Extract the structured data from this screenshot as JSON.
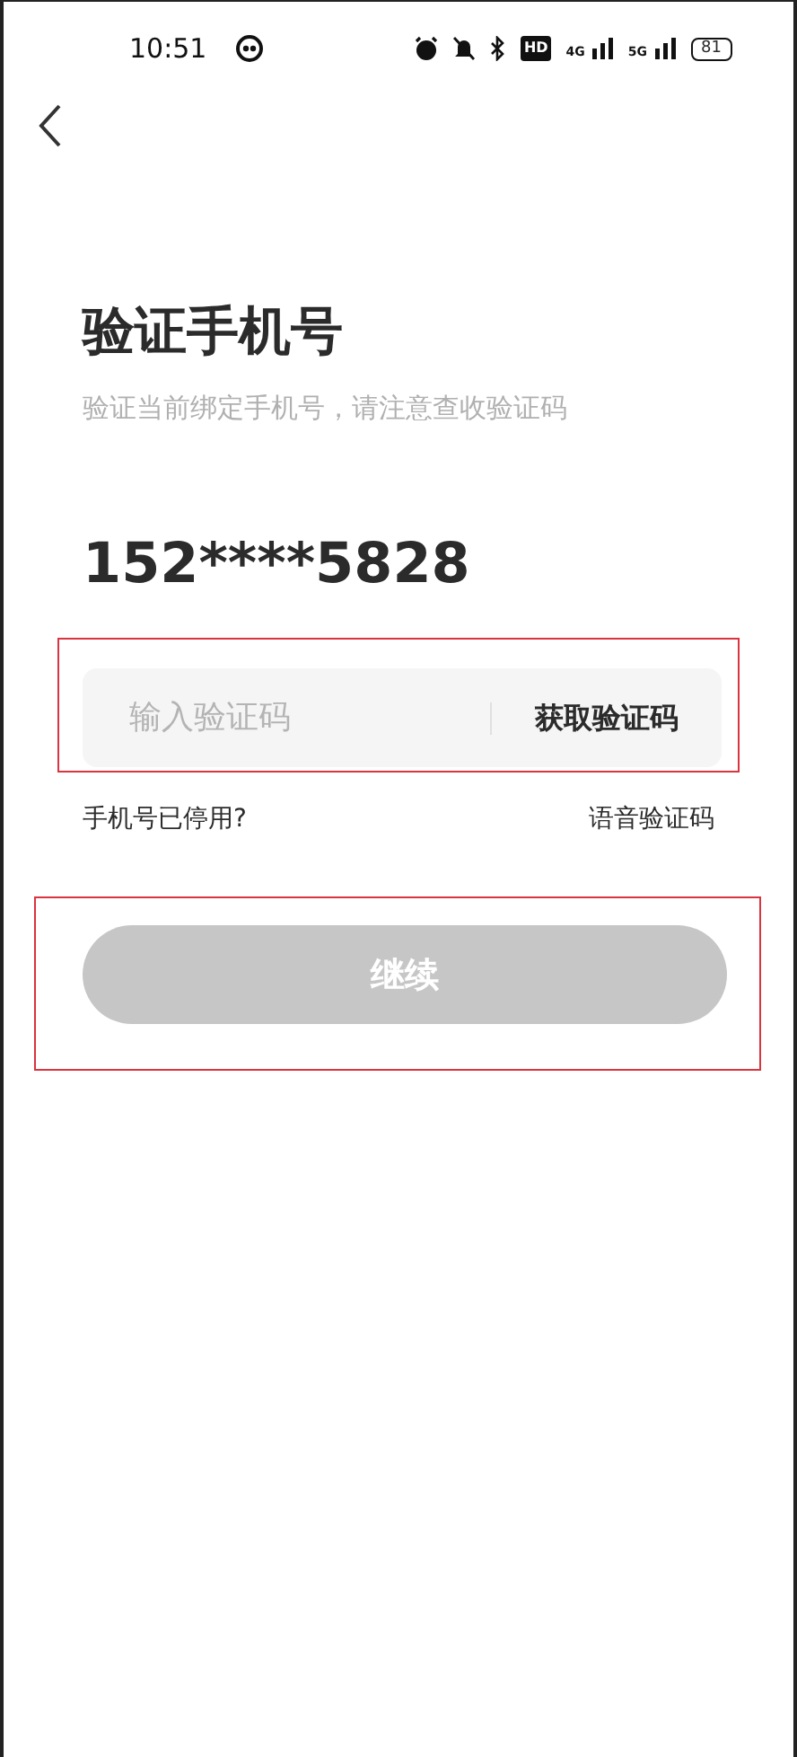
{
  "status_bar": {
    "time": "10:51",
    "hd": "HD",
    "network_1": "4G",
    "network_2": "5G",
    "battery": "81"
  },
  "title": "验证手机号",
  "subtitle": "验证当前绑定手机号，请注意查收验证码",
  "phone": "152****5828",
  "code_field": {
    "placeholder": "输入验证码",
    "action": "获取验证码"
  },
  "links": [
    "手机号已停用?",
    "语音验证码"
  ],
  "continue_button": {
    "label": "继续",
    "disabled": true
  }
}
